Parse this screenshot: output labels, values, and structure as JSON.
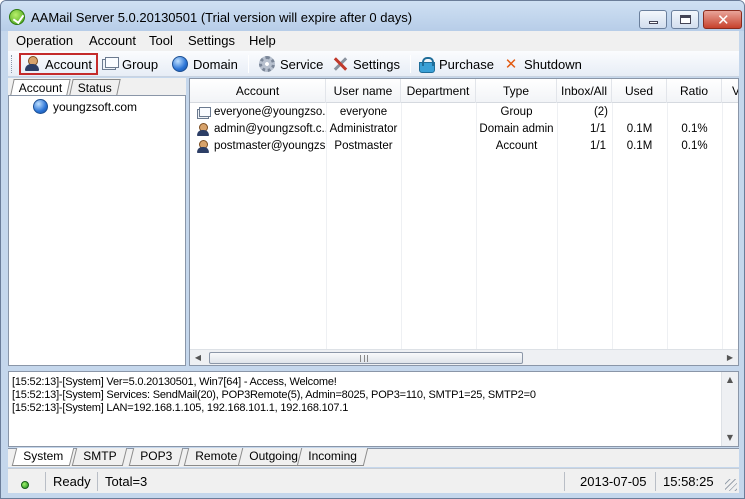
{
  "window": {
    "title": "AAMail Server 5.0.20130501 (Trial version will expire after 0 days)",
    "app_icon": "aamail-logo-icon",
    "controls": {
      "minimize": "minimize-icon",
      "maximize": "maximize-icon",
      "close": "✕"
    }
  },
  "menu": {
    "items": [
      "Operation",
      "Account",
      "Tool",
      "Settings",
      "Help"
    ]
  },
  "toolbar": {
    "account": "Account",
    "group": "Group",
    "domain": "Domain",
    "service": "Service",
    "settings": "Settings",
    "purchase": "Purchase",
    "shutdown": "Shutdown",
    "selected": "Account",
    "selected_outline_color": "#c42b2b"
  },
  "left_panel": {
    "tabs": [
      "Account",
      "Status"
    ],
    "active_tab": "Account",
    "tree": [
      {
        "label": "youngzsoft.com",
        "icon": "globe-icon"
      }
    ]
  },
  "account_list": {
    "columns": [
      "Account",
      "User name",
      "Department",
      "Type",
      "Inbox/All",
      "Used",
      "Ratio",
      "V"
    ],
    "rows": [
      {
        "icon": "group-icon",
        "account": "everyone@youngzso...",
        "username": "everyone",
        "department": "",
        "type": "Group",
        "inbox_all": "(2)",
        "used": "",
        "ratio": ""
      },
      {
        "icon": "person-icon",
        "account": "admin@youngzsoft.c...",
        "username": "Administrator",
        "department": "",
        "type": "Domain admin",
        "inbox_all": "1/1",
        "used": "0.1M",
        "ratio": "0.1%"
      },
      {
        "icon": "person-icon",
        "account": "postmaster@youngzs...",
        "username": "Postmaster",
        "department": "",
        "type": "Account",
        "inbox_all": "1/1",
        "used": "0.1M",
        "ratio": "0.1%"
      }
    ]
  },
  "log": {
    "lines": [
      "[15:52:13]-[System] Ver=5.0.20130501, Win7[64] - Access, Welcome!",
      "[15:52:13]-[System] Services: SendMail(20), POP3Remote(5), Admin=8025, POP3=110, SMTP1=25, SMTP2=0",
      "[15:52:13]-[System] LAN=192.168.1.105, 192.168.101.1, 192.168.107.1"
    ]
  },
  "bottom_tabs": {
    "items": [
      "System",
      "SMTP",
      "POP3",
      "Remote",
      "Outgoing",
      "Incoming"
    ],
    "active": "System"
  },
  "status": {
    "state": "Ready",
    "total": "Total=3",
    "date": "2013-07-05",
    "time": "15:58:25",
    "indicator_color": "#1f8a1f"
  }
}
